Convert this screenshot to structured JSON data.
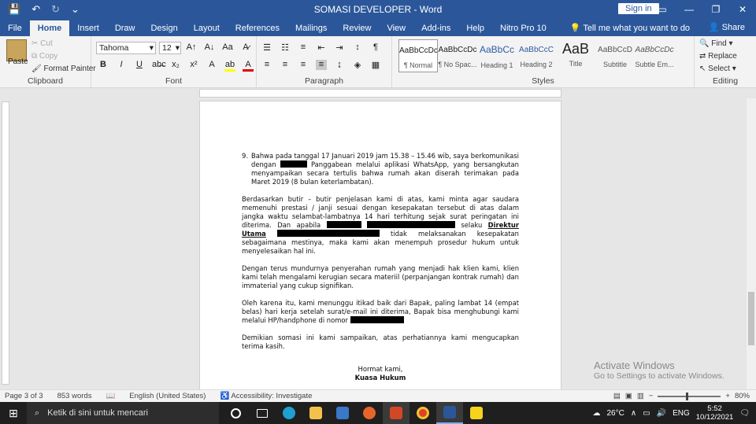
{
  "titlebar": {
    "title": "SOMASI DEVELOPER  -  Word",
    "signin": "Sign in",
    "save_icon": "💾",
    "undo_icon": "↶",
    "redo_icon": "↻",
    "qat_more": "⌄"
  },
  "tabs": [
    "File",
    "Home",
    "Insert",
    "Draw",
    "Design",
    "Layout",
    "References",
    "Mailings",
    "Review",
    "View",
    "Add-ins",
    "Help",
    "Nitro Pro 10"
  ],
  "tellme": "Tell me what you want to do",
  "share": "Share",
  "ribbon": {
    "clipboard": {
      "paste": "Paste",
      "cut": "Cut",
      "copy": "Copy",
      "format_painter": "Format Painter",
      "label": "Clipboard"
    },
    "font": {
      "name": "Tahoma",
      "size": "12",
      "label": "Font"
    },
    "paragraph": {
      "label": "Paragraph"
    },
    "styles": {
      "label": "Styles",
      "items": [
        {
          "preview": "AaBbCcDc",
          "name": "¶ Normal"
        },
        {
          "preview": "AaBbCcDc",
          "name": "¶ No Spac..."
        },
        {
          "preview": "AaBbCc",
          "name": "Heading 1"
        },
        {
          "preview": "AaBbCcC",
          "name": "Heading 2"
        },
        {
          "preview": "AaB",
          "name": "Title"
        },
        {
          "preview": "AaBbCcD",
          "name": "Subtitle"
        },
        {
          "preview": "AaBbCcDc",
          "name": "Subtle Em..."
        }
      ]
    },
    "editing": {
      "find": "Find",
      "replace": "Replace",
      "select": "Select",
      "label": "Editing"
    }
  },
  "document": {
    "item9_num": "9.",
    "item9_a": "Bahwa pada tanggal 17 Januari 2019 jam 15.38 – 15.46 wib, saya berkomunikasi dengan",
    "item9_b": "Panggabean melalui aplikasi WhatsApp, yang bersangkutan menyampaikan secara tertulis bahwa rumah akan diserah terimakan pada Maret 2019 (8 bulan keterlambatan).",
    "p1_a": "Berdasarkan butir – butir penjelasan kami di atas, kami minta agar saudara memenuhi prestasi / janji sesuai dengan kesepakatan tersebut di atas dalam jangka waktu selambat-lambatnya 14 hari terhitung sejak surat peringatan ini diterima. Dan apabila",
    "p1_b": "selaku",
    "p1_c": "Direktur Utama",
    "p1_d": "tidak melaksanakan kesepakatan sebagaimana mestinya, maka kami akan menempuh prosedur hukum untuk menyelesaikan hal ini.",
    "p2": "Dengan terus mundurnya penyerahan rumah yang menjadi hak klien kami, klien kami telah mengalami kerugian secara materiil (perpanjangan kontrak rumah) dan immaterial yang cukup signifikan.",
    "p3": "Oleh karena itu, kami menunggu itikad baik dari Bapak, paling lambat 14 (empat belas) hari kerja setelah surat/e-mail ini diterima, Bapak bisa menghubungi kami melalui HP/handphone di nomor",
    "p4": "Demikian somasi ini kami sampaikan, atas perhatiannya kami mengucapkan terima kasih.",
    "closing1": "Hormat kami,",
    "closing2": "Kuasa Hukum"
  },
  "watermark": {
    "line1": "Activate Windows",
    "line2": "Go to Settings to activate Windows."
  },
  "status": {
    "page": "Page 3 of 3",
    "words": "853 words",
    "language": "English (United States)",
    "accessibility": "Accessibility: Investigate",
    "zoom": "80%"
  },
  "taskbar": {
    "search_placeholder": "Ketik di sini untuk mencari",
    "weather": "26°C",
    "lang": "ENG",
    "time": "5:52",
    "date": "10/12/2021"
  }
}
